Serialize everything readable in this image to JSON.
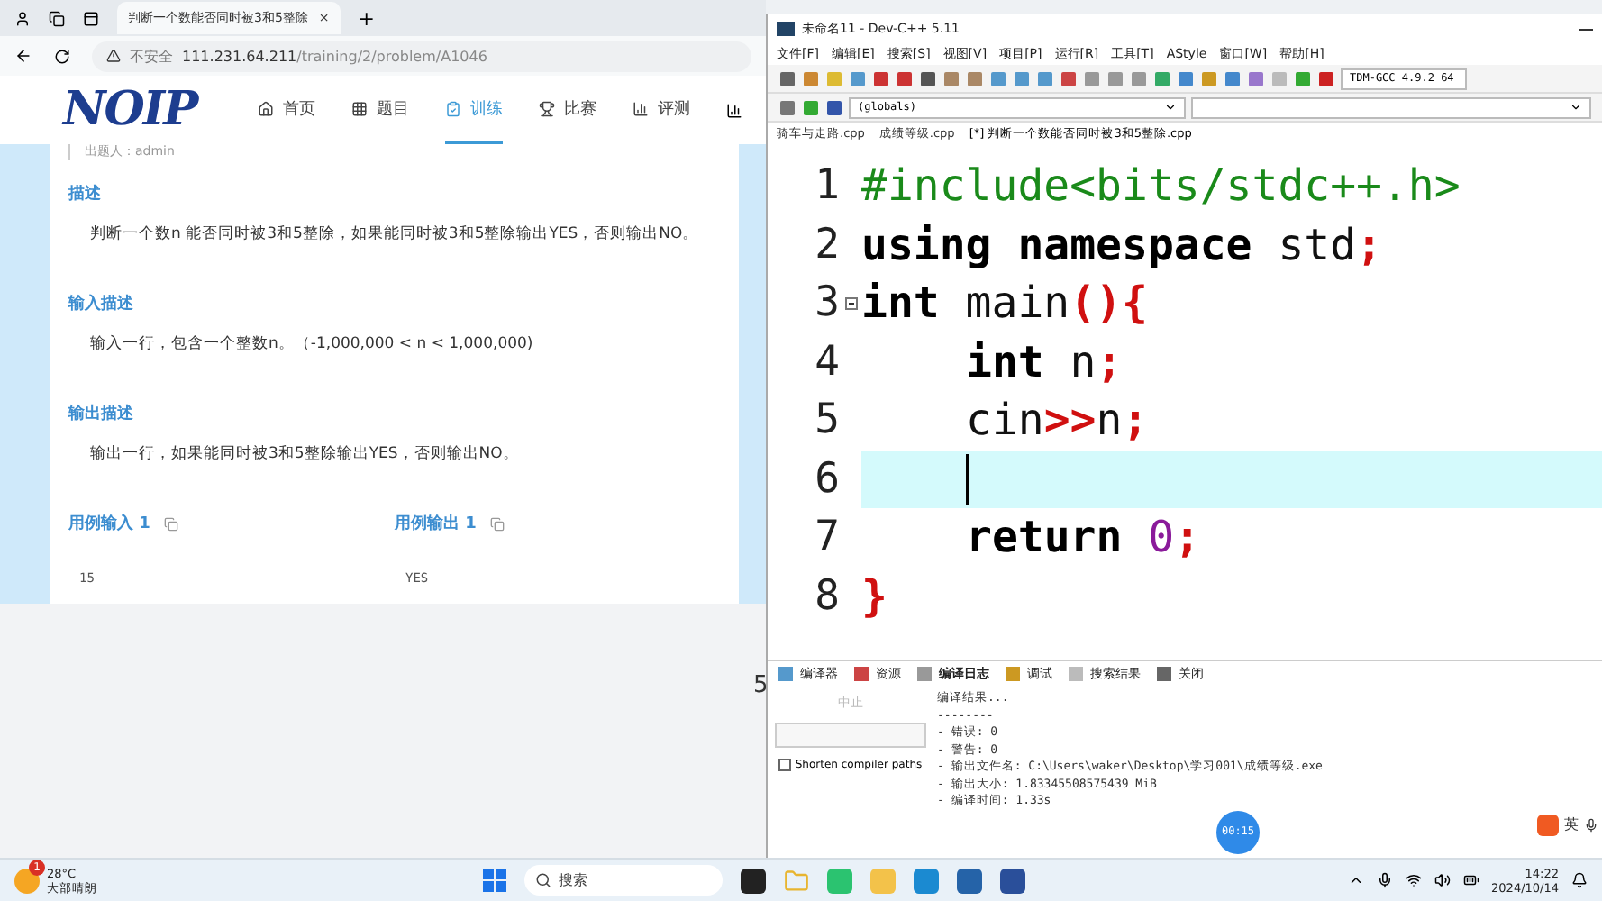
{
  "browser": {
    "tab": {
      "title": "判断一个数能否同时被3和5整除",
      "close": "×"
    },
    "new_tab": "+",
    "address": {
      "warning": "不安全",
      "url_host": "111.231.64.211",
      "url_path": "/training/2/problem/A1046"
    },
    "site": {
      "logo": "NOIP",
      "nav": [
        {
          "label": "首页",
          "selected": false
        },
        {
          "label": "题目",
          "selected": false
        },
        {
          "label": "训练",
          "selected": true
        },
        {
          "label": "比赛",
          "selected": false
        },
        {
          "label": "评测",
          "selected": false
        }
      ],
      "author": "出题人：admin",
      "sections": [
        {
          "heading": "描述",
          "text": "判断一个数n 能否同时被3和5整除，如果能同时被3和5整除输出YES，否则输出NO。"
        },
        {
          "heading": "输入描述",
          "text": "输入一行，包含一个整数n。（-1,000,000 < n < 1,000,000)"
        },
        {
          "heading": "输出描述",
          "text": "输出一行，如果能同时被3和5整除输出YES，否则输出NO。"
        }
      ],
      "samples": [
        {
          "heading": "用例输入 1",
          "value": "15"
        },
        {
          "heading": "用例输出 1",
          "value": "YES"
        }
      ]
    },
    "stray": "5"
  },
  "devcpp": {
    "title": "未命名11 - Dev-C++ 5.11",
    "menu": [
      "文件[F]",
      "编辑[E]",
      "搜索[S]",
      "视图[V]",
      "项目[P]",
      "运行[R]",
      "工具[T]",
      "AStyle",
      "窗口[W]",
      "帮助[H]"
    ],
    "compiler": "TDM-GCC 4.9.2 64",
    "scope": "(globals)",
    "files": [
      {
        "name": "骑车与走路.cpp",
        "selected": false
      },
      {
        "name": "成绩等级.cpp",
        "selected": false
      },
      {
        "name": "[*] 判断一个数能否同时被3和5整除.cpp",
        "selected": true
      }
    ],
    "code": [
      {
        "number": "1",
        "current": false,
        "tokens": [
          {
            "text": "#include<bits/stdc++.h>",
            "kind": "preproc"
          }
        ]
      },
      {
        "number": "2",
        "current": false,
        "tokens": [
          {
            "text": "using namespace",
            "kind": "keyword"
          },
          {
            "text": " std",
            "kind": "plain"
          },
          {
            "text": ";",
            "kind": "symbol"
          }
        ]
      },
      {
        "number": "3",
        "current": false,
        "fold": true,
        "tokens": [
          {
            "text": "int",
            "kind": "keyword"
          },
          {
            "text": " main",
            "kind": "plain"
          },
          {
            "text": "(){",
            "kind": "symbol"
          }
        ]
      },
      {
        "number": "4",
        "current": false,
        "indent": true,
        "tokens": [
          {
            "text": "int",
            "kind": "keyword"
          },
          {
            "text": " n",
            "kind": "plain"
          },
          {
            "text": ";",
            "kind": "symbol"
          }
        ]
      },
      {
        "number": "5",
        "current": false,
        "indent": true,
        "tokens": [
          {
            "text": "cin",
            "kind": "plain"
          },
          {
            "text": ">>",
            "kind": "symbol"
          },
          {
            "text": "n",
            "kind": "plain"
          },
          {
            "text": ";",
            "kind": "symbol"
          }
        ]
      },
      {
        "number": "6",
        "current": true,
        "indent": true
      },
      {
        "number": "7",
        "current": false,
        "indent": true,
        "tokens": [
          {
            "text": "return",
            "kind": "keyword"
          },
          {
            "text": " 0",
            "kind": "number"
          },
          {
            "text": ";",
            "kind": "symbol"
          }
        ]
      },
      {
        "number": "8",
        "current": false,
        "tokens": [
          {
            "text": "}",
            "kind": "symbol"
          }
        ]
      }
    ],
    "panel_tabs": [
      {
        "label": "编译器",
        "selected": false
      },
      {
        "label": "资源",
        "selected": false
      },
      {
        "label": "编译日志",
        "selected": true
      },
      {
        "label": "调试",
        "selected": false
      },
      {
        "label": "搜索结果",
        "selected": false
      },
      {
        "label": "关闭",
        "selected": false
      }
    ],
    "abort": {
      "label": "中止",
      "disabled": true
    },
    "shorten_paths": {
      "label": "Shorten compiler paths",
      "checked": false
    },
    "log": [
      "编译结果...",
      "--------",
      "- 错误: 0",
      "- 警告: 0",
      "- 输出文件名: C:\\Users\\waker\\Desktop\\学习001\\成绩等级.exe",
      "- 输出大小: 1.83345508575439 MiB",
      "- 编译时间: 1.33s"
    ]
  },
  "recorder": "00:15",
  "ime": "英",
  "taskbar": {
    "weather": {
      "temp": "28°C",
      "desc": "大部晴朗",
      "badge": "1"
    },
    "search": "搜索",
    "time": "14:22",
    "date": "2024/10/14"
  }
}
